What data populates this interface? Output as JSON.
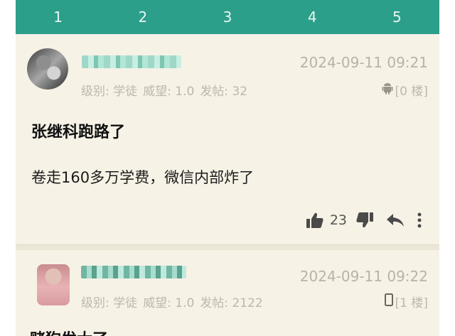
{
  "tabs": [
    "1",
    "2",
    "3",
    "4",
    "5"
  ],
  "posts": [
    {
      "date": "2024-09-11 09:21",
      "level": "级别: 学徒",
      "prestige": "威望: 1.0",
      "posts_count": "发帖: 32",
      "device_icon": "android-icon",
      "floor": "[0 楼]",
      "title": "张继科跑路了",
      "body": "卷走160多万学费，微信内部炸了",
      "likes": "23"
    },
    {
      "date": "2024-09-11 09:22",
      "level": "级别: 学徒",
      "prestige": "威望: 1.0",
      "posts_count": "发帖: 2122",
      "device_icon": "phone-icon",
      "floor": "[1 楼]",
      "body": "赌狗发大了"
    }
  ],
  "colors": {
    "accent": "#2c9f8a",
    "background": "#f7f2e6",
    "meta_text": "#bdb8ac"
  }
}
